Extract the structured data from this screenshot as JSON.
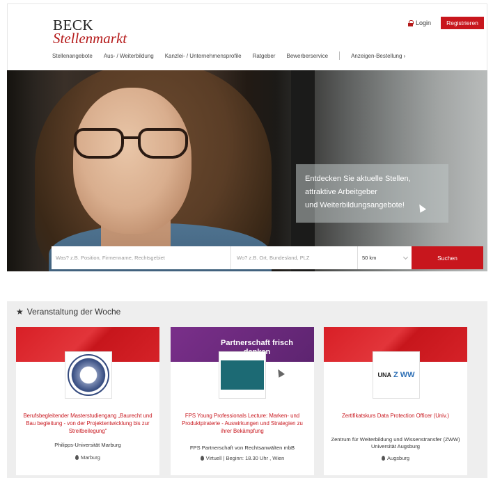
{
  "header": {
    "logo_line1": "BECK",
    "logo_line2": "Stellenmarkt",
    "login_label": "Login",
    "register_label": "Registrieren",
    "nav": [
      {
        "label": "Stellenangebote"
      },
      {
        "label": "Aus- / Weiterbildung"
      },
      {
        "label": "Kanzlei- / Unternehmensprofile"
      },
      {
        "label": "Ratgeber"
      },
      {
        "label": "Bewerberservice"
      },
      {
        "label": "Anzeigen-Bestellung ›"
      }
    ]
  },
  "hero": {
    "promo_lines": [
      "Entdecken Sie aktuelle Stellen,",
      "attraktive Arbeitgeber",
      "und Weiterbildungsangebote!"
    ]
  },
  "search": {
    "what_placeholder": "Was? z.B. Position, Firmenname, Rechtsgebiet",
    "where_placeholder": "Wo? z.B. Ort, Bundesland, PLZ",
    "radius_value": "50 km",
    "submit_label": "Suchen"
  },
  "events": {
    "section_title": "Veranstaltung der Woche",
    "cards": [
      {
        "title": "Berufsbegleitender Masterstudiengang „Baurecht und Bau begleitung - von der Projektentwicklung bis zur Streitbeilegung“",
        "org": "Philipps-Universität Marburg",
        "location": "Marburg"
      },
      {
        "banner": "Partnerschaft frisch denken",
        "title": "FPS Young Professionals Lecture: Marken- und Produktpiraterie - Auswirkungen und Strategien zu ihrer Bekämpfung",
        "org": "FPS Partnerschaft von Rechtsanwälten mbB",
        "location": "Virtuell | Beginn: 18.30 Uhr , Wien"
      },
      {
        "logo_text": "UNA",
        "logo_z": "Z WW",
        "title": "Zertifikatskurs Data Protection Officer (Univ.)",
        "org": "Zentrum für Weiterbildung und Wissenstransfer (ZWW) Universität Augsburg",
        "location": "Augsburg"
      }
    ]
  },
  "colors": {
    "brand_red": "#c8161d",
    "section_bg": "#eeeeee"
  }
}
